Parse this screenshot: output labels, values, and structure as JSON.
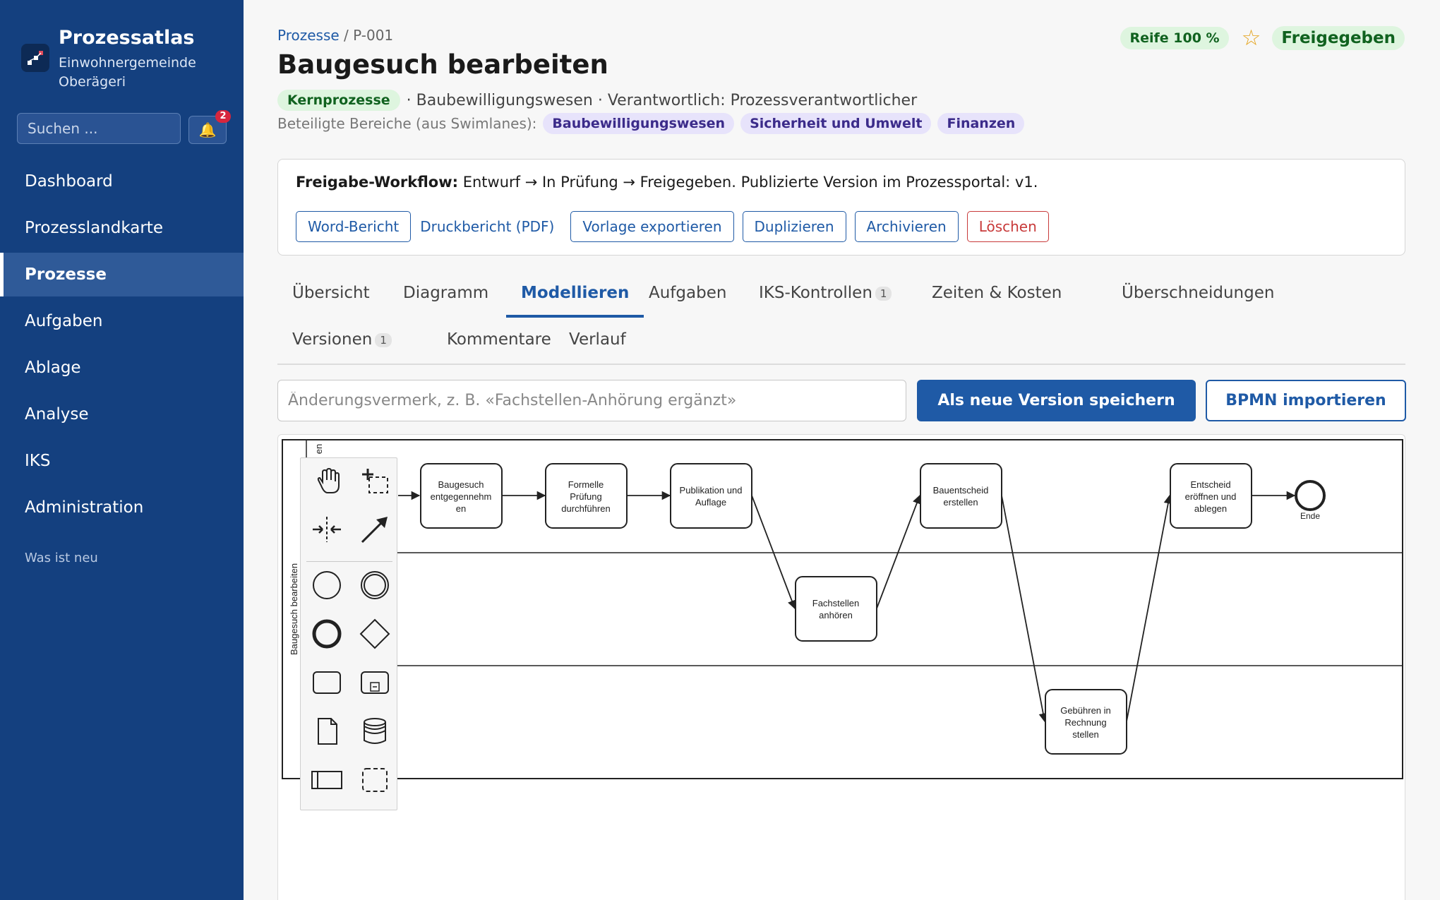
{
  "sidebar": {
    "app_title": "Prozessatlas",
    "org_name": "Einwohnergemeinde Oberägeri",
    "search_placeholder": "Suchen ...",
    "notification_count": "2",
    "nav": [
      "Dashboard",
      "Prozesslandkarte",
      "Prozesse",
      "Aufgaben",
      "Ablage",
      "Analyse",
      "IKS",
      "Administration"
    ],
    "active_nav": "Prozesse",
    "whats_new": "Was ist neu"
  },
  "header": {
    "breadcrumb_link": "Prozesse",
    "breadcrumb_sep": " / ",
    "breadcrumb_current": "P-001",
    "title": "Baugesuch bearbeiten",
    "category_badge": "Kernprozesse",
    "meta_text": "· Baubewilligungswesen · Verantwortlich: Prozessverantwortlicher",
    "areas_label": "Beteiligte Bereiche (aus Swimlanes):",
    "areas": [
      "Baubewilligungswesen",
      "Sicherheit und Umwelt",
      "Finanzen"
    ],
    "maturity_badge": "Reife 100 %",
    "star_icon": "☆",
    "status_badge": "Freigegeben"
  },
  "workflow": {
    "label": "Freigabe-Workflow:",
    "text": "Entwurf → In Prüfung → Freigegeben. Publizierte Version im Prozessportal: v1.",
    "buttons": {
      "word": "Word-Bericht",
      "pdf": "Druckbericht (PDF)",
      "export": "Vorlage exportieren",
      "duplicate": "Duplizieren",
      "archive": "Archivieren",
      "delete": "Löschen"
    }
  },
  "tabs": {
    "overview": "Übersicht",
    "diagram": "Diagramm",
    "model": "Modellieren",
    "tasks": "Aufgaben",
    "iks": "IKS-Kontrollen",
    "iks_count": "1",
    "times": "Zeiten & Kosten",
    "overlaps": "Überschneidungen",
    "versions": "Versionen",
    "versions_count": "1",
    "comments": "Kommentare",
    "history": "Verlauf"
  },
  "editor": {
    "change_placeholder": "Änderungsvermerk, z. B. «Fachstellen-Anhörung ergänzt»",
    "save_button": "Als neue Version speichern",
    "import_button": "BPMN importieren"
  },
  "diagram": {
    "pool_label": "Baugesuch bearbeiten",
    "lane_label_partial": "en",
    "tasks": {
      "t1": [
        "Baugesuch",
        "entgegennehm",
        "en"
      ],
      "t2": [
        "Formelle",
        "Prüfung",
        "durchführen"
      ],
      "t3": [
        "Publikation und",
        "Auflage"
      ],
      "t4": [
        "Fachstellen",
        "anhören"
      ],
      "t5": [
        "Bauentscheid",
        "erstellen"
      ],
      "t6": [
        "Gebühren in",
        "Rechnung",
        "stellen"
      ],
      "t7": [
        "Entscheid",
        "eröffnen und",
        "ablegen"
      ]
    },
    "end_label": "Ende",
    "colors": {
      "stroke": "#222222",
      "primary": "#1f5aa6",
      "sidebar": "#14407f"
    }
  },
  "palette_tools": [
    "hand-tool-icon",
    "lasso-tool-icon",
    "space-tool-icon",
    "connect-tool-icon",
    "start-event-icon",
    "intermediate-event-icon",
    "end-event-icon",
    "gateway-icon",
    "task-icon",
    "subprocess-icon",
    "data-object-icon",
    "data-store-icon",
    "pool-icon",
    "group-icon"
  ]
}
